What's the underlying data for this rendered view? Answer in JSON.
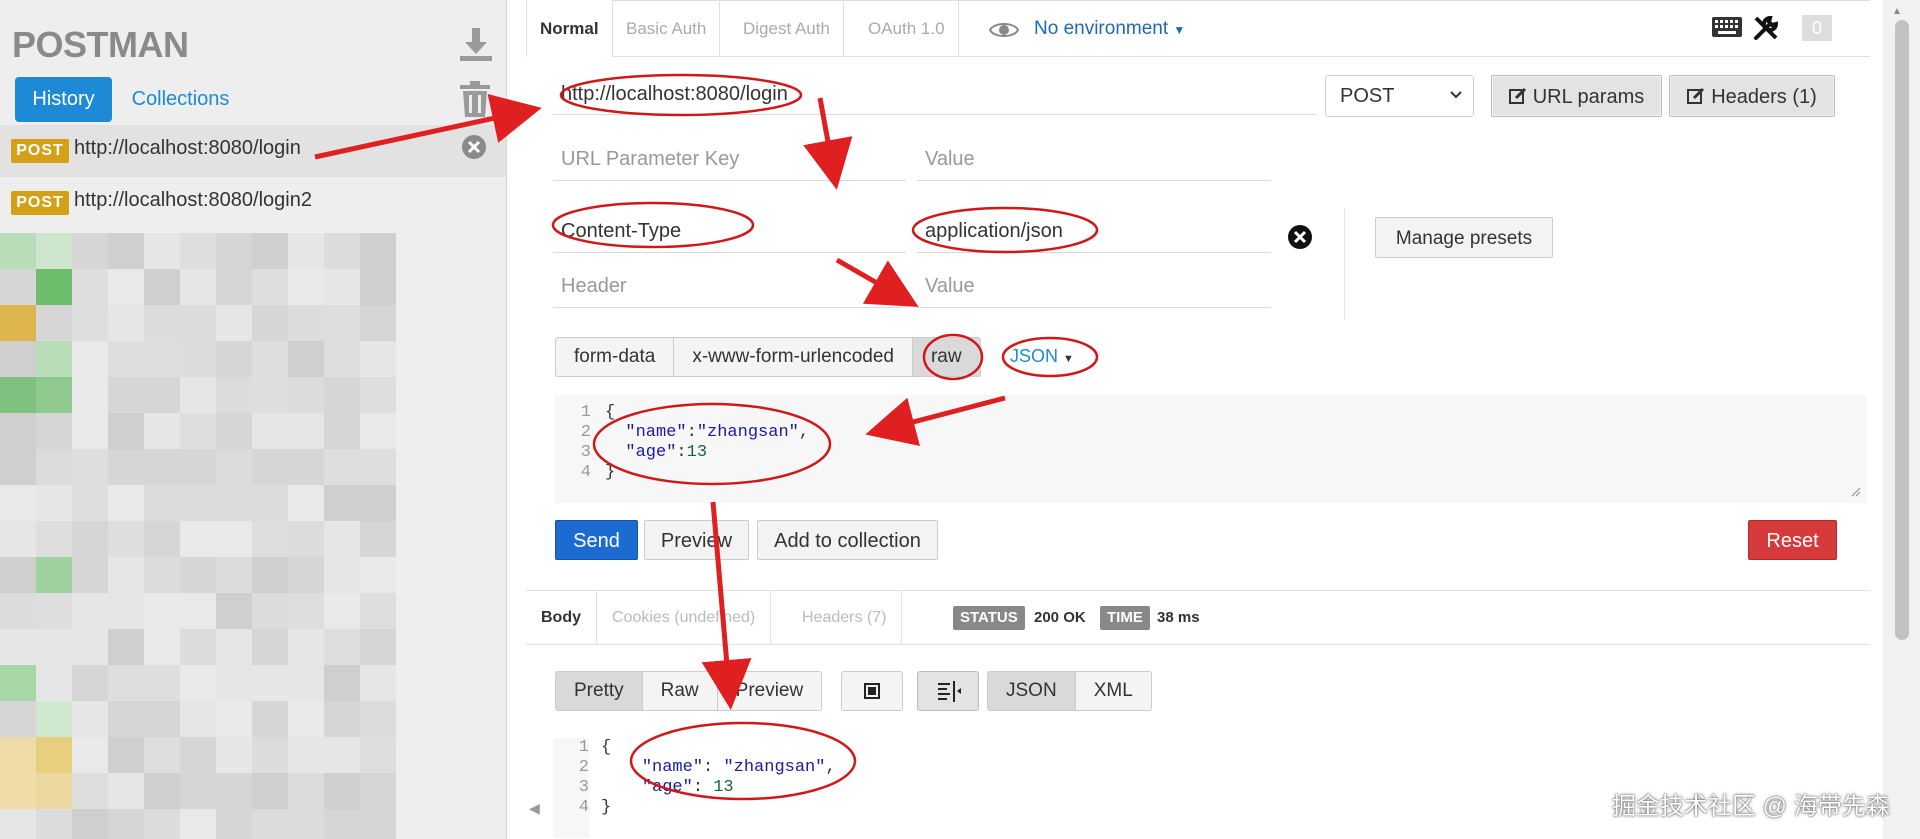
{
  "sidebar": {
    "logo": "POSTMAN",
    "tabs": {
      "history": "History",
      "collections": "Collections"
    },
    "history": [
      {
        "method": "POST",
        "url": "http://localhost:8080/login"
      },
      {
        "method": "POST",
        "url": "http://localhost:8080/login2"
      }
    ]
  },
  "auth_tabs": [
    "Normal",
    "Basic Auth",
    "Digest Auth",
    "OAuth 1.0"
  ],
  "environment": "No environment",
  "notifications": "0",
  "request": {
    "url": "http://localhost:8080/login",
    "method": "POST",
    "url_params_label": "URL params",
    "headers_label": "Headers (1)",
    "param_key_placeholder": "URL Parameter Key",
    "param_value_placeholder": "Value",
    "header_key": "Content-Type",
    "header_value": "application/json",
    "header_key_placeholder": "Header",
    "header_value_placeholder": "Value",
    "manage_presets": "Manage presets",
    "body_modes": [
      "form-data",
      "x-www-form-urlencoded",
      "raw"
    ],
    "body_mode_selected": "raw",
    "body_format": "JSON",
    "body_lines": [
      "1",
      "2",
      "3",
      "4"
    ],
    "body_code": [
      "{",
      "  \"name\":\"zhangsan\",",
      "  \"age\":13",
      "}"
    ],
    "send": "Send",
    "preview": "Preview",
    "add_to_collection": "Add to collection",
    "reset": "Reset"
  },
  "response": {
    "tabs": [
      "Body",
      "Cookies (undefined)",
      "Headers (7)"
    ],
    "status_label": "STATUS",
    "status_value": "200 OK",
    "time_label": "TIME",
    "time_value": "38 ms",
    "view_modes": [
      "Pretty",
      "Raw",
      "Preview"
    ],
    "formats": [
      "JSON",
      "XML"
    ],
    "body_lines": [
      "1",
      "2",
      "3",
      "4"
    ],
    "body_code": [
      "{",
      "    \"name\": \"zhangsan\",",
      "    \"age\": 13",
      "}"
    ]
  },
  "watermark": "掘金技术社区 @ 海带先森",
  "colors": {
    "accent": "#1e8ad6",
    "send": "#1b6bd0",
    "reset": "#d63a3a",
    "badge": "#d4a017",
    "annotation": "#e02020"
  }
}
